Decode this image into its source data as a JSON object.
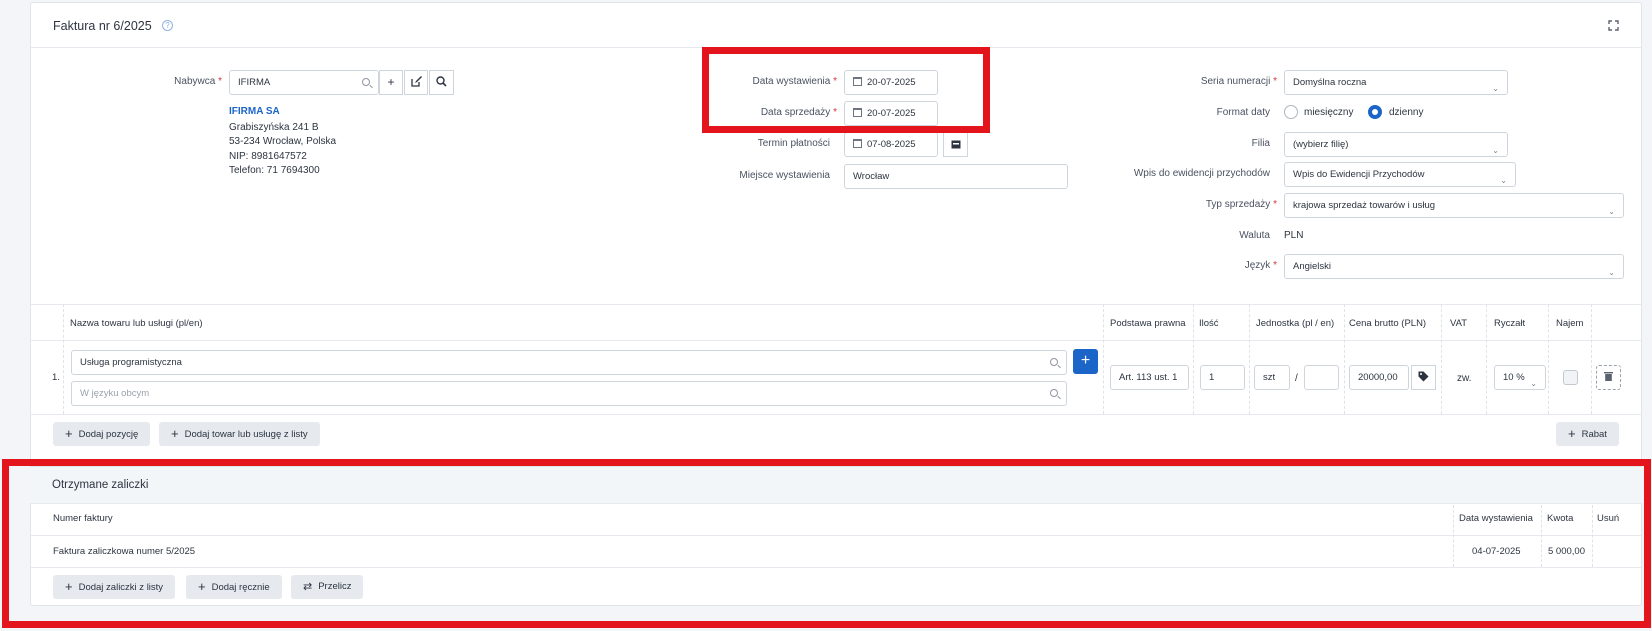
{
  "header": {
    "title": "Faktura nr 6/2025",
    "help_icon": "question-circle-icon",
    "expand_icon": "expand-icon"
  },
  "buyer": {
    "label": "Nabywca",
    "value": "IFIRMA",
    "name": "IFIRMA SA",
    "address1": "Grabiszyńska 241 B",
    "address2": "53-234 Wrocław, Polska",
    "nip": "NIP: 8981647572",
    "phone": "Telefon: 71 7694300"
  },
  "dates": {
    "issue_label": "Data wystawienia",
    "issue_value": "20-07-2025",
    "sale_label": "Data sprzedaży",
    "sale_value": "20-07-2025",
    "due_label": "Termin płatności",
    "due_value": "07-08-2025",
    "place_label": "Miejsce wystawienia",
    "place_value": "Wrocław"
  },
  "settings": {
    "series_label": "Seria numeracji",
    "series_value": "Domyślna roczna",
    "date_format_label": "Format daty",
    "date_format_monthly": "miesięczny",
    "date_format_daily": "dzienny",
    "branch_label": "Filia",
    "branch_value": "(wybierz filię)",
    "revenue_label": "Wpis do ewidencji przychodów",
    "revenue_value": "Wpis do Ewidencji Przychodów",
    "sale_type_label": "Typ sprzedaży",
    "sale_type_value": "krajowa sprzedaż towarów i usług",
    "currency_label": "Waluta",
    "currency_value": "PLN",
    "language_label": "Język",
    "language_value": "Angielski"
  },
  "items": {
    "headers": {
      "name": "Nazwa towaru lub usługi (pl/en)",
      "legal": "Podstawa prawna",
      "qty": "Ilość",
      "unit": "Jednostka (pl / en)",
      "price": "Cena brutto (PLN)",
      "vat": "VAT",
      "flat": "Ryczałt",
      "rent": "Najem"
    },
    "row": {
      "index": "1.",
      "name": "Usługa programistyczna",
      "foreign_placeholder": "W języku obcym",
      "legal": "Art. 113 ust. 1",
      "qty": "1",
      "unit": "szt",
      "unit_sep": "/",
      "price": "20000,00",
      "vat": "zw.",
      "flat": "10 %"
    },
    "add_position": "Dodaj pozycję",
    "add_from_list": "Dodaj towar lub usługę z listy",
    "discount": "Rabat"
  },
  "advances": {
    "title": "Otrzymane zaliczki",
    "headers": {
      "number": "Numer faktury",
      "date": "Data wystawienia",
      "amount": "Kwota",
      "remove": "Usuń"
    },
    "rows": [
      {
        "number": "Faktura zaliczkowa numer 5/2025",
        "date": "04-07-2025",
        "amount": "5 000,00"
      }
    ],
    "add_from_list": "Dodaj zaliczki z listy",
    "add_manual": "Dodaj ręcznie",
    "recalc": "Przelicz"
  },
  "colors": {
    "accent": "#1c65c8",
    "highlight": "#e3141c",
    "required": "#d6323a"
  }
}
